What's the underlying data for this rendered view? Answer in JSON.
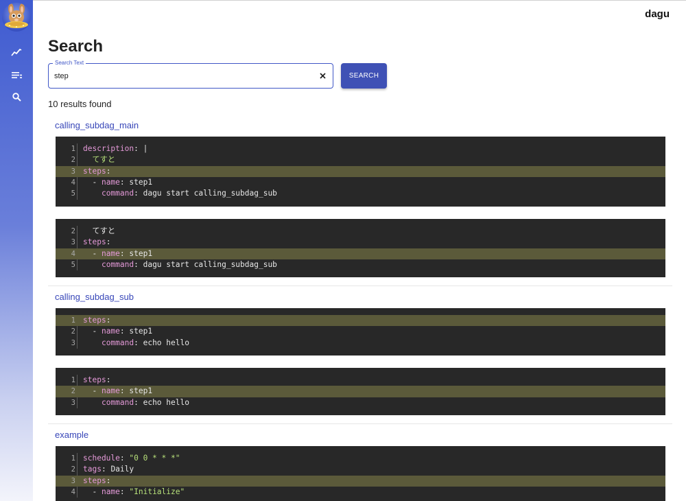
{
  "app": {
    "title": "dagu"
  },
  "page": {
    "title": "Search"
  },
  "search": {
    "label": "Search Text",
    "value": "step",
    "button_label": "SEARCH",
    "result_count_text": "10 results found"
  },
  "nav": [
    {
      "icon": "chart-line-icon"
    },
    {
      "icon": "list-icon"
    },
    {
      "icon": "search-icon"
    }
  ],
  "results": [
    {
      "name": "calling_subdag_main",
      "snippets": [
        [
          {
            "n": "1",
            "key": "description",
            "sep": ": ",
            "val": "|",
            "hl": false
          },
          {
            "n": "2",
            "indent": "  ",
            "val": "てすと",
            "hl": false,
            "plain_green": true
          },
          {
            "n": "3",
            "key": "steps",
            "sep": ":",
            "val": "",
            "hl": true
          },
          {
            "n": "4",
            "indent": "  - ",
            "key": "name",
            "sep": ": ",
            "val": "step1",
            "hl": false
          },
          {
            "n": "5",
            "indent": "    ",
            "key": "command",
            "sep": ": ",
            "val": "dagu start calling_subdag_sub",
            "hl": false
          }
        ],
        [
          {
            "n": "2",
            "indent": "  ",
            "val": "てすと",
            "hl": false
          },
          {
            "n": "3",
            "key": "steps",
            "sep": ":",
            "val": "",
            "hl": false
          },
          {
            "n": "4",
            "indent": "  - ",
            "key": "name",
            "sep": ": ",
            "val": "step1",
            "hl": true
          },
          {
            "n": "5",
            "indent": "    ",
            "key": "command",
            "sep": ": ",
            "val": "dagu start calling_subdag_sub",
            "hl": false
          }
        ]
      ]
    },
    {
      "name": "calling_subdag_sub",
      "snippets": [
        [
          {
            "n": "1",
            "key": "steps",
            "sep": ":",
            "val": "",
            "hl": true
          },
          {
            "n": "2",
            "indent": "  - ",
            "key": "name",
            "sep": ": ",
            "val": "step1",
            "hl": false
          },
          {
            "n": "3",
            "indent": "    ",
            "key": "command",
            "sep": ": ",
            "val": "echo hello",
            "hl": false
          }
        ],
        [
          {
            "n": "1",
            "key": "steps",
            "sep": ":",
            "val": "",
            "hl": false
          },
          {
            "n": "2",
            "indent": "  - ",
            "key": "name",
            "sep": ": ",
            "val": "step1",
            "hl": true
          },
          {
            "n": "3",
            "indent": "    ",
            "key": "command",
            "sep": ": ",
            "val": "echo hello",
            "hl": false
          }
        ]
      ]
    },
    {
      "name": "example",
      "snippets": [
        [
          {
            "n": "1",
            "key": "schedule",
            "sep": ": ",
            "val": "\"0 0 * * *\"",
            "hl": false,
            "str": true
          },
          {
            "n": "2",
            "key": "tags",
            "sep": ": ",
            "val": "Daily",
            "hl": false
          },
          {
            "n": "3",
            "key": "steps",
            "sep": ":",
            "val": "",
            "hl": true
          },
          {
            "n": "4",
            "indent": "  - ",
            "key": "name",
            "sep": ": ",
            "val": "\"Initialize\"",
            "hl": false,
            "str": true
          }
        ]
      ]
    }
  ]
}
